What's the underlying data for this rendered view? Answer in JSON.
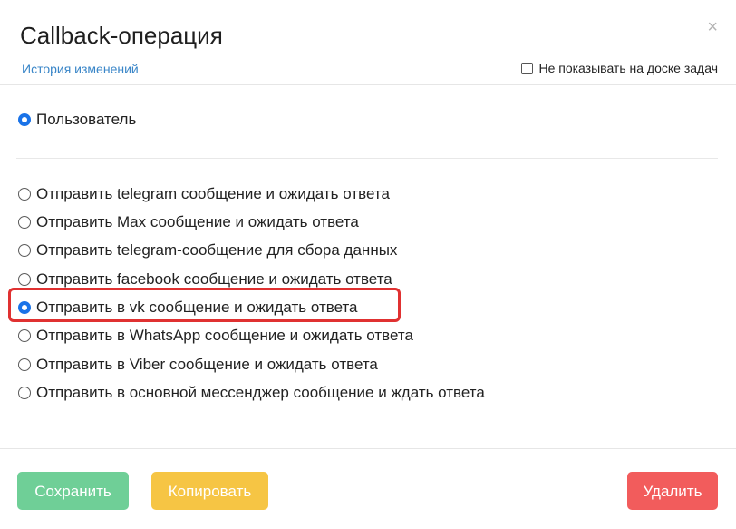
{
  "dialog": {
    "title": "Callback-операция",
    "close_symbol": "×",
    "history_link": "История изменений",
    "hide_board_label": "Не показывать на доске задач",
    "hide_board_checked": false
  },
  "user_option": {
    "label": "Пользователь",
    "checked": true
  },
  "options": [
    {
      "label": "Отправить telegram сообщение и ожидать ответа",
      "checked": false
    },
    {
      "label": "Отправить Max сообщение и ожидать ответа",
      "checked": false
    },
    {
      "label": "Отправить telegram-сообщение для сбора данных",
      "checked": false
    },
    {
      "label": "Отправить facebook сообщение и ожидать ответа",
      "checked": false
    },
    {
      "label": "Отправить в vk сообщение и ожидать ответа",
      "checked": true
    },
    {
      "label": "Отправить в WhatsApp сообщение и ожидать ответа",
      "checked": false
    },
    {
      "label": "Отправить в Viber сообщение и ожидать ответа",
      "checked": false
    },
    {
      "label": "Отправить в основной мессенджер сообщение и ждать ответа",
      "checked": false
    }
  ],
  "buttons": {
    "save": "Сохранить",
    "copy": "Копировать",
    "delete": "Удалить"
  },
  "colors": {
    "accent": "#1a73e8",
    "link": "#3a86c8",
    "save": "#6fcf97",
    "copy": "#f6c544",
    "delete": "#f25c5c",
    "highlight": "#e03131"
  }
}
